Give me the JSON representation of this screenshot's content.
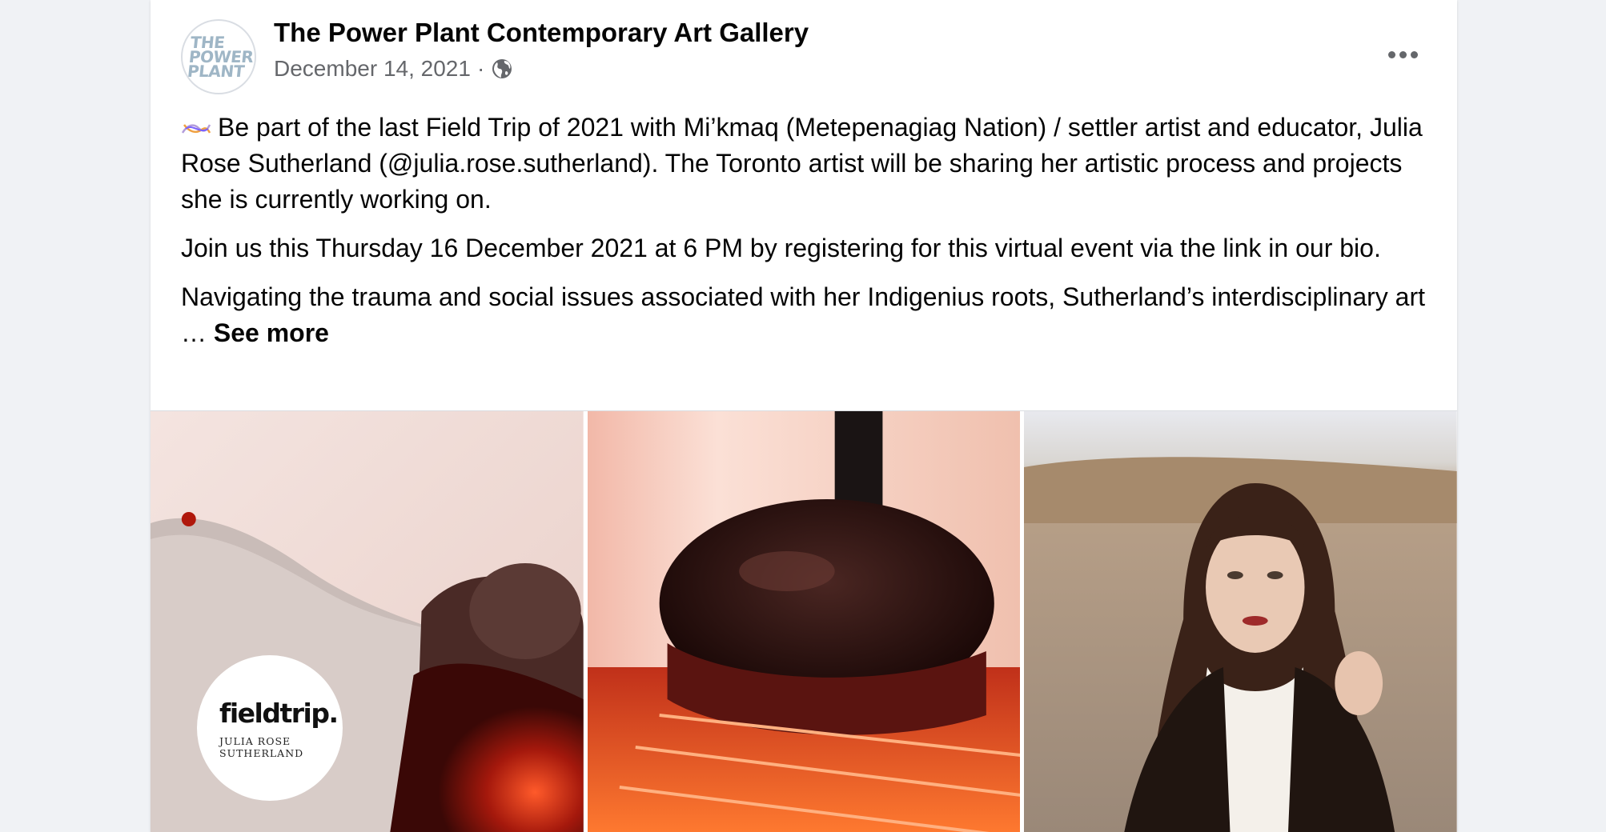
{
  "post": {
    "page_name": "The Power Plant Contemporary Art Gallery",
    "avatar_lines": [
      "THE",
      "POWER",
      "PLANT"
    ],
    "date": "December 14, 2021",
    "separator": "·",
    "privacy_icon": "globe-icon",
    "more_icon": "more-horizontal-icon",
    "paragraphs": [
      "Be part of the last Field Trip of 2021 with Mi’kmaq (Metepenagiag Nation) / settler artist and educator, Julia Rose Sutherland (@julia.rose.sutherland). The Toronto artist will be sharing her artistic process and projects she is currently working on.",
      "Join us this Thursday 16 December 2021 at 6 PM by registering for this virtual event via the link in our bio."
    ],
    "truncated_paragraph": "Navigating the trauma and social issues associated with her Indigenius roots, Sutherland’s interdisciplinary art",
    "ellipsis": " … ",
    "see_more": "See more",
    "emoji_icon": "sparkles-icon"
  },
  "gallery": {
    "badge_title": "fieldtrip.",
    "badge_subtitle": "JULIA ROSE SUTHERLAND"
  },
  "colors": {
    "background": "#f0f2f5",
    "card": "#ffffff",
    "primary_text": "#050505",
    "secondary_text": "#65676b"
  }
}
